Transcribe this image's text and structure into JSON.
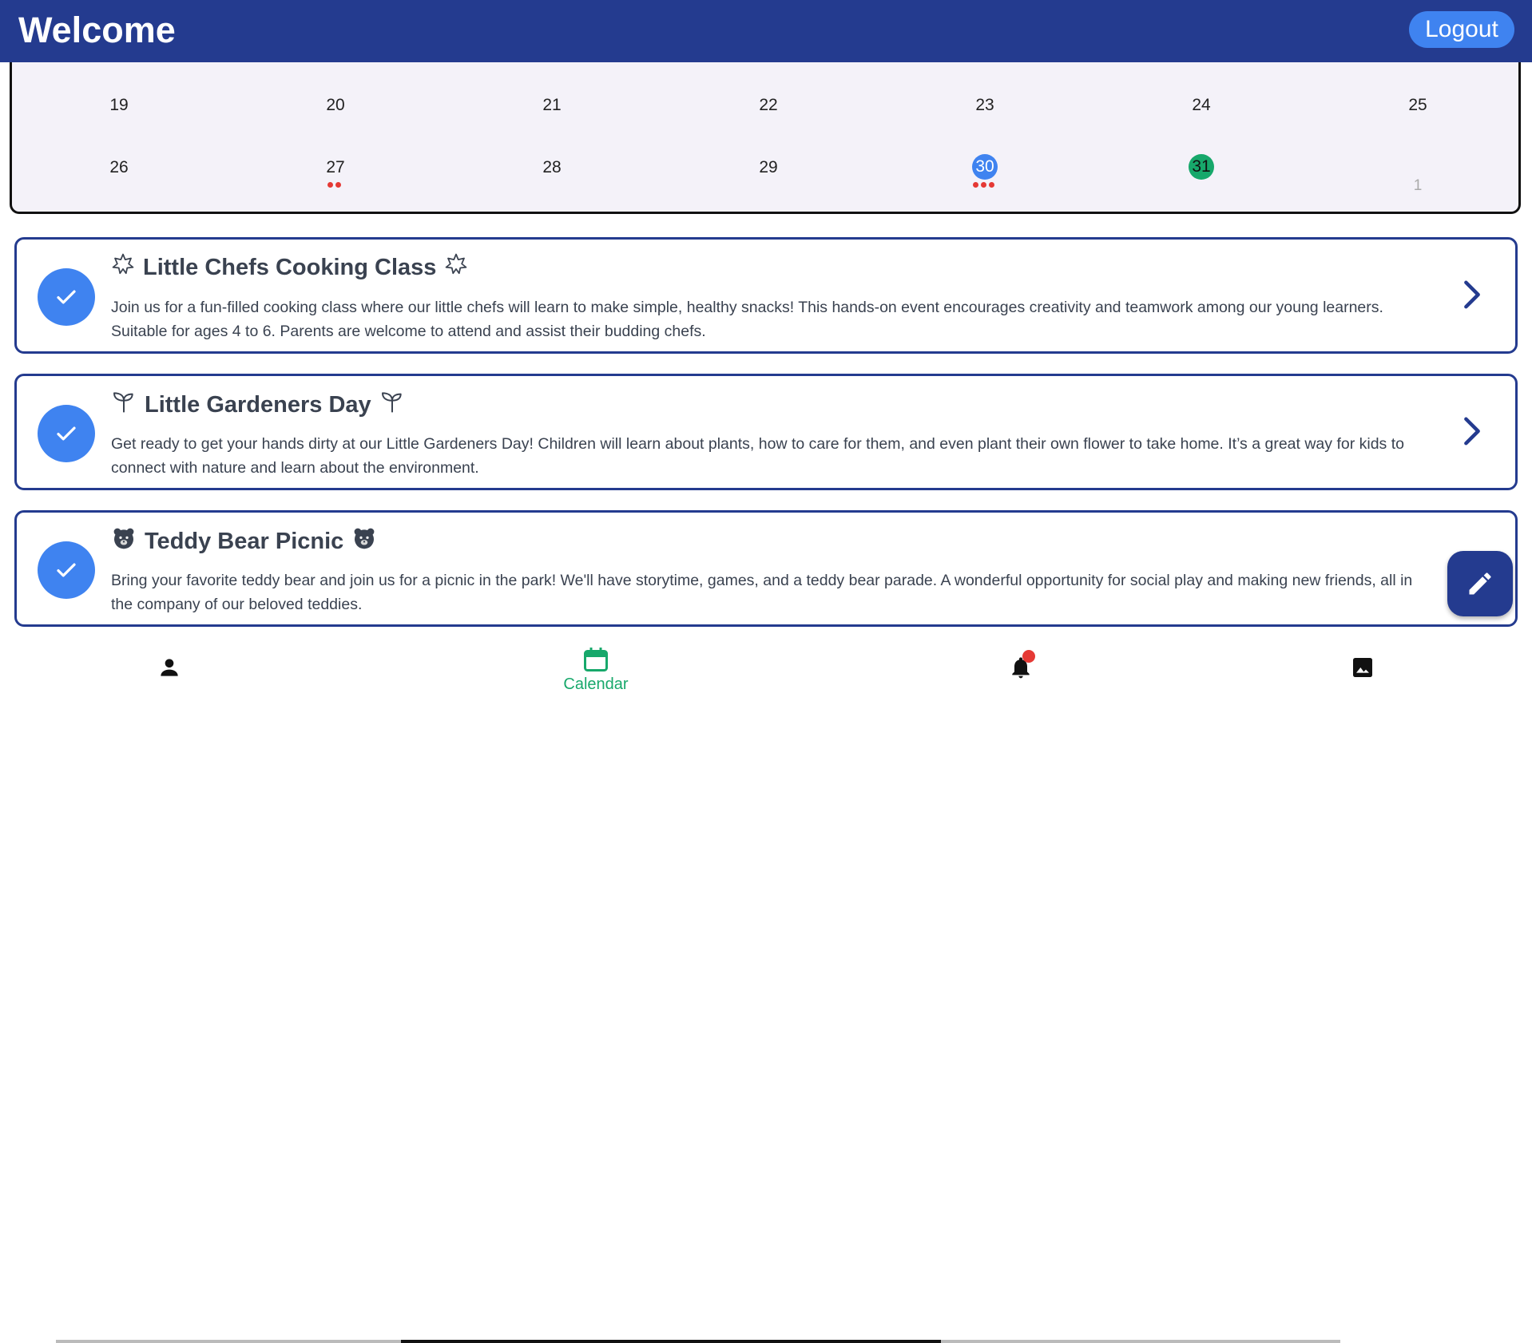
{
  "app": {
    "title": "Welcome",
    "logout_label": "Logout"
  },
  "colors": {
    "primary": "#243b8f",
    "accent": "#3f83f0",
    "success": "#17a86b",
    "dot": "#e53935"
  },
  "calendar": {
    "week1": [
      "19",
      "20",
      "21",
      "22",
      "23",
      "24",
      "25"
    ],
    "week2": [
      "26",
      "27",
      "28",
      "29",
      "30",
      "31",
      "1"
    ],
    "event_dots": {
      "27": 2,
      "30": 3
    },
    "selected_day": "30",
    "today": "31"
  },
  "events": [
    {
      "title": "Little Chefs Cooking Class",
      "icon": "sparkle-icon",
      "description": "Join us for a fun-filled cooking class where our little chefs will learn to make simple, healthy snacks! This hands-on event encourages creativity and teamwork among our young learners. Suitable for ages 4 to 6. Parents are welcome to attend and assist their budding chefs."
    },
    {
      "title": "Little Gardeners Day",
      "icon": "sprout-icon",
      "description": "Get ready to get your hands dirty at our Little Gardeners Day! Children will learn about plants, how to care for them, and even plant their own flower to take home. It’s a great way for kids to connect with nature and learn about the environment."
    },
    {
      "title": "Teddy Bear Picnic",
      "icon": "bear-icon",
      "description": "Bring your favorite teddy bear and join us for a picnic in the park! We'll have storytime, games, and a teddy bear parade. A wonderful opportunity for social play and making new friends, all in the company of our beloved teddies."
    }
  ],
  "nav": {
    "calendar_label": "Calendar"
  }
}
